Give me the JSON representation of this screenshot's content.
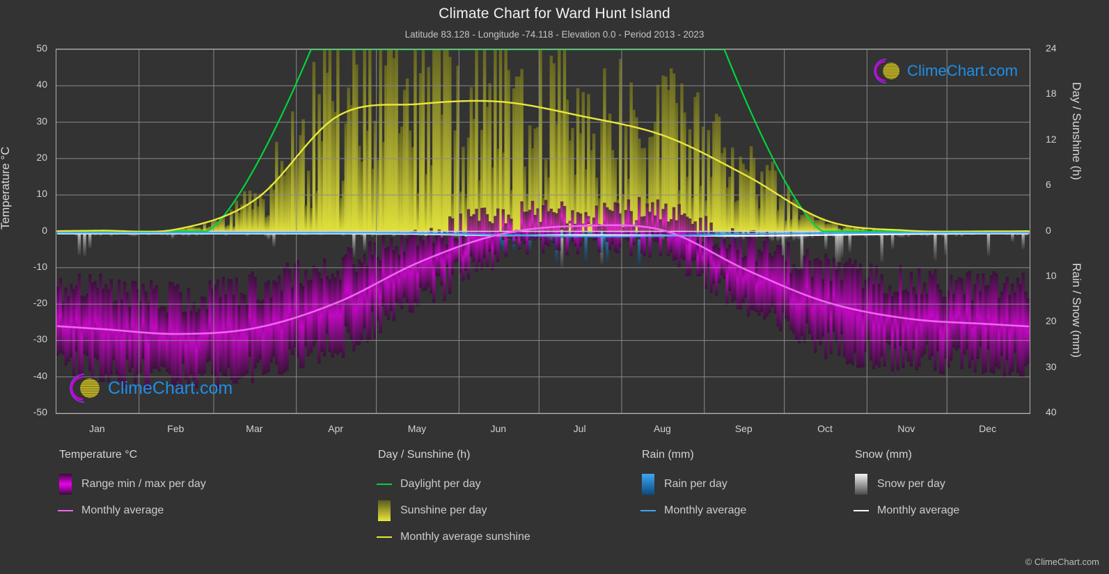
{
  "header": {
    "title": "Climate Chart for Ward Hunt Island",
    "subtitle": "Latitude 83.128 - Longitude -74.118 - Elevation 0.0 - Period 2013 - 2023"
  },
  "branding": {
    "logo_text": "ClimeChart.com",
    "copyright": "© ClimeChart.com",
    "logo_blue": "#1f8fe8",
    "logo_magenta": "#cc00cc",
    "logo_yellow": "#d4c828"
  },
  "axes": {
    "left": {
      "title": "Temperature °C",
      "ticks": [
        "50",
        "40",
        "30",
        "20",
        "10",
        "0",
        "-10",
        "-20",
        "-30",
        "-40",
        "-50"
      ],
      "min": -50,
      "max": 50,
      "step": 10
    },
    "right_top": {
      "title": "Day / Sunshine (h)",
      "ticks": [
        "24",
        "18",
        "12",
        "6",
        "0"
      ],
      "min": 0,
      "max": 24,
      "step": 6
    },
    "right_bottom": {
      "title": "Rain / Snow (mm)",
      "ticks": [
        "0",
        "10",
        "20",
        "30",
        "40"
      ],
      "min": 0,
      "max": 40,
      "step": 10
    },
    "x": {
      "ticks": [
        "Jan",
        "Feb",
        "Mar",
        "Apr",
        "May",
        "Jun",
        "Jul",
        "Aug",
        "Sep",
        "Oct",
        "Nov",
        "Dec"
      ]
    }
  },
  "legend": {
    "groups": [
      {
        "heading": "Temperature °C",
        "items": [
          {
            "label": "Range min / max per day",
            "marker": "gradient",
            "color": "#ee00ee"
          },
          {
            "label": "Monthly average",
            "marker": "line",
            "color": "#ee66ee"
          }
        ]
      },
      {
        "heading": "Day / Sunshine (h)",
        "items": [
          {
            "label": "Daylight per day",
            "marker": "line",
            "color": "#00d53c"
          },
          {
            "label": "Sunshine per day",
            "marker": "gradient",
            "color": "#e8e83c"
          },
          {
            "label": "Monthly average sunshine",
            "marker": "line",
            "color": "#e8e83c"
          }
        ]
      },
      {
        "heading": "Rain (mm)",
        "items": [
          {
            "label": "Rain per day",
            "marker": "gradient",
            "color": "#1f8fe8"
          },
          {
            "label": "Monthly average",
            "marker": "line",
            "color": "#3fa7f0"
          }
        ]
      },
      {
        "heading": "Snow (mm)",
        "items": [
          {
            "label": "Snow per day",
            "marker": "gradient",
            "color": "#e8e8e8"
          },
          {
            "label": "Monthly average",
            "marker": "line",
            "color": "#ffffff"
          }
        ]
      }
    ]
  },
  "chart_data": {
    "type": "line",
    "title": "Climate Chart for Ward Hunt Island",
    "subtitle": "Latitude 83.128 - Longitude -74.118 - Elevation 0.0 - Period 2013 - 2023",
    "xlabel": "",
    "ylabel": "Temperature °C",
    "ylim": [
      -50,
      50
    ],
    "grid": true,
    "legend_position": "bottom",
    "categories": [
      "Jan",
      "Feb",
      "Mar",
      "Apr",
      "May",
      "Jun",
      "Jul",
      "Aug",
      "Sep",
      "Oct",
      "Nov",
      "Dec"
    ],
    "series": [
      {
        "name": "Monthly average temperature",
        "unit": "°C",
        "axis": "left",
        "color": "#ee66ee",
        "values": [
          -26.8,
          -28.2,
          -26.5,
          -19.5,
          -8.5,
          -0.8,
          1.5,
          0.2,
          -10.5,
          -19.5,
          -24.0,
          -25.5
        ]
      },
      {
        "name": "Daily temperature min per day",
        "unit": "°C",
        "axis": "left",
        "color": "#ee00ee",
        "values": [
          -38.0,
          -40.0,
          -38.0,
          -31.0,
          -19.0,
          -6.0,
          -2.0,
          -5.0,
          -21.0,
          -31.0,
          -35.0,
          -36.0
        ]
      },
      {
        "name": "Daily temperature max per day",
        "unit": "°C",
        "axis": "left",
        "color": "#ee00ee",
        "values": [
          -16.0,
          -18.0,
          -15.0,
          -9.0,
          -1.0,
          3.0,
          6.0,
          4.0,
          -3.0,
          -10.0,
          -14.0,
          -15.0
        ]
      },
      {
        "name": "Daylight per day",
        "unit": "h",
        "axis": "right_top",
        "color": "#00d53c",
        "values": [
          0.0,
          0.0,
          8.0,
          24.0,
          24.0,
          24.0,
          24.0,
          24.0,
          17.0,
          2.0,
          0.0,
          0.0
        ]
      },
      {
        "name": "Monthly average sunshine",
        "unit": "h",
        "axis": "right_top",
        "color": "#e8e83c",
        "values": [
          0.1,
          0.3,
          4.3,
          15.2,
          16.8,
          17.1,
          15.2,
          12.6,
          7.4,
          1.4,
          0.1,
          0.0
        ]
      },
      {
        "name": "Rain monthly average",
        "unit": "mm",
        "axis": "right_bottom",
        "color": "#3fa7f0",
        "values": [
          0.3,
          0.3,
          0.3,
          0.3,
          0.4,
          0.8,
          1.1,
          1.0,
          0.6,
          0.4,
          0.3,
          0.3
        ]
      },
      {
        "name": "Snow monthly average",
        "unit": "mm",
        "axis": "right_bottom",
        "color": "#ffffff",
        "values": [
          0.5,
          0.5,
          0.5,
          0.5,
          0.6,
          0.9,
          0.8,
          0.9,
          1.0,
          0.8,
          0.6,
          0.5
        ]
      }
    ],
    "notes": "Daily range bars (magenta) show min/max temperature per day; grey vertical bars show daily snow, blue bars daily rain, yellow bars daily sunshine hours."
  }
}
